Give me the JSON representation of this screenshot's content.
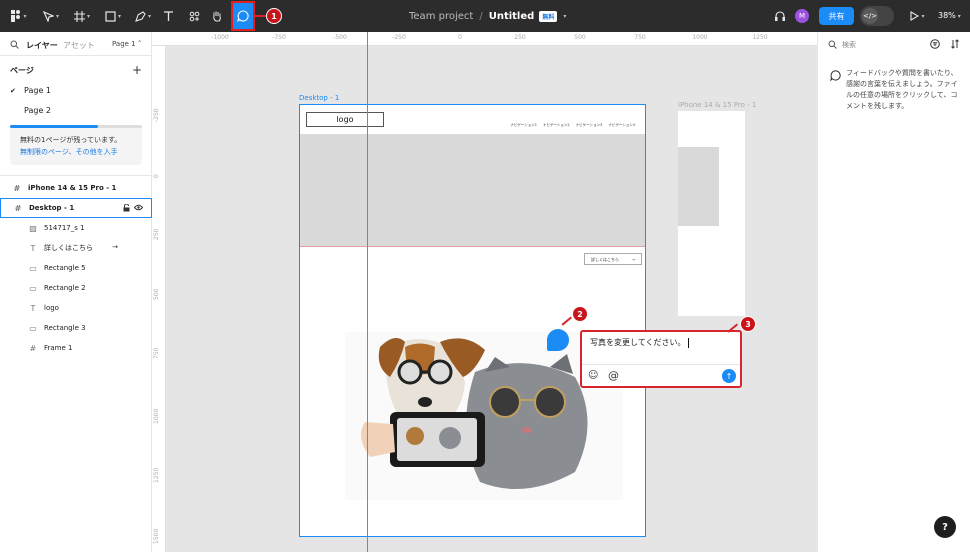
{
  "toolbar": {
    "project": "Team project",
    "separator": "/",
    "file": "Untitled",
    "plan_badge": "無料",
    "share_label": "共有",
    "avatar_initial": "M",
    "zoom": "38%",
    "dev_mode_symbol": "</>",
    "icons": [
      "figma-menu-icon",
      "move-tool-icon",
      "frame-tool-icon",
      "shape-tool-icon",
      "pen-tool-icon",
      "text-tool-icon",
      "resources-icon",
      "hand-tool-icon",
      "comment-tool-icon",
      "headphones-icon",
      "play-icon"
    ]
  },
  "callouts": {
    "one": "1",
    "two": "2",
    "three": "3"
  },
  "left_panel": {
    "tab_layers": "レイヤー",
    "tab_assets": "アセット",
    "page_select": "Page 1",
    "pages_title": "ページ",
    "pages": [
      "Page 1",
      "Page 2"
    ],
    "upsell_line1": "無料の1ページが残っています。",
    "upsell_line2": "無制限のページ、その他を入手",
    "upsell_progress": 0.67,
    "layers": {
      "iphone": "iPhone 14 & 15 Pro - 1",
      "desktop": "Desktop - 1",
      "img": "514717_s 1",
      "text_more": "詳しくはこちら",
      "rect5": "Rectangle 5",
      "rect2": "Rectangle 2",
      "logo": "logo",
      "rect3": "Rectangle 3",
      "frame1": "Frame 1"
    }
  },
  "canvas": {
    "ruler_top": [
      "-1000",
      "-750",
      "-500",
      "-250",
      "0",
      "250",
      "500",
      "750",
      "1000",
      "1250"
    ],
    "ruler_left": [
      "-250",
      "0",
      "250",
      "500",
      "750",
      "1000",
      "1250",
      "1500"
    ],
    "desktop_label": "Desktop - 1",
    "iphone_label": "iPhone 14 & 15 Pro - 1",
    "logo_text": "logo",
    "nav_items": [
      "ナビゲーション1",
      "ナビゲーション2",
      "ナビゲーション3",
      "ナビゲーション4"
    ],
    "more_button": "詳しくはこちら",
    "more_arrow": "→"
  },
  "comment": {
    "text": "写真を変更してください。",
    "emoji_icon": "☺",
    "mention_symbol": "@",
    "send_icon": "↑"
  },
  "right_panel": {
    "search_placeholder": "検索",
    "hint": "フィードバックや質問を書いたり、感謝の言葉を伝えましょう。ファイルの任意の場所をクリックして、コメントを残します。"
  },
  "help_label": "?",
  "colors": {
    "accent": "#1b8bf5",
    "callout": "#c8151b",
    "toolbar": "#2c2c2c"
  }
}
